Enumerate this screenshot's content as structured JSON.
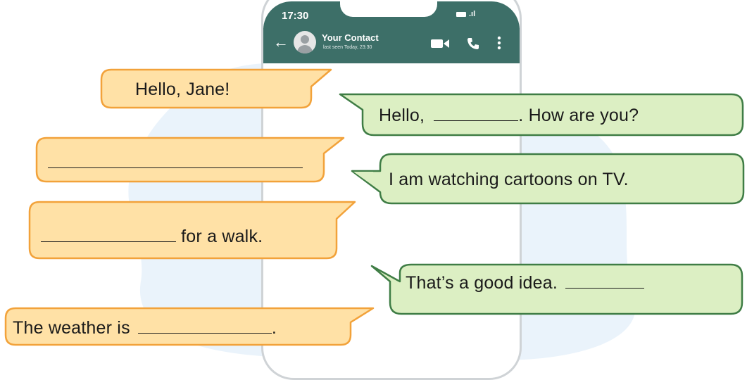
{
  "phone": {
    "status_time": "17:30",
    "contact_name": "Your Contact",
    "contact_status": "last seen Today, 23:30",
    "header_color": "#3d6f68"
  },
  "icons": [
    "back-arrow-icon",
    "avatar",
    "video-call-icon",
    "phone-call-icon",
    "more-options-icon",
    "battery-icon",
    "signal-icon"
  ],
  "colors": {
    "left_bubble_fill": "#ffe1a6",
    "left_bubble_border": "#f2a23a",
    "right_bubble_fill": "#dcefc3",
    "right_bubble_border": "#3f7d45",
    "blob": "#eaf3fb"
  },
  "messages": [
    {
      "side": "left",
      "before": "Hello, Jane!",
      "after": ""
    },
    {
      "side": "right",
      "before": "Hello,",
      "after": ". How are you?"
    },
    {
      "side": "left",
      "before": "",
      "after": ""
    },
    {
      "side": "right",
      "before": "I am watching cartoons on TV.",
      "after": ""
    },
    {
      "side": "left",
      "before": "",
      "after": "for a walk."
    },
    {
      "side": "right",
      "before": "That’s a good idea.",
      "after": ""
    },
    {
      "side": "left",
      "before": "The weather is",
      "after": "."
    }
  ]
}
